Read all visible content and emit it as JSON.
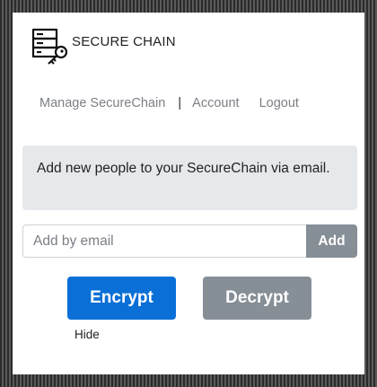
{
  "header": {
    "title": "SECURE CHAIN",
    "logo_icon": "server-key-icon"
  },
  "nav": {
    "manage_label": "Manage SecureChain",
    "separator": "|",
    "account_label": "Account",
    "logout_label": "Logout"
  },
  "info": {
    "message": "Add new people to your SecureChain via email."
  },
  "email": {
    "placeholder": "Add by email",
    "value": "",
    "add_label": "Add"
  },
  "actions": {
    "encrypt_label": "Encrypt",
    "decrypt_label": "Decrypt",
    "hide_label": "Hide"
  },
  "colors": {
    "primary": "#0a6fd6",
    "secondary": "#868e96",
    "info_bg": "#e6e9ec",
    "nav_text": "#7b7f85"
  }
}
